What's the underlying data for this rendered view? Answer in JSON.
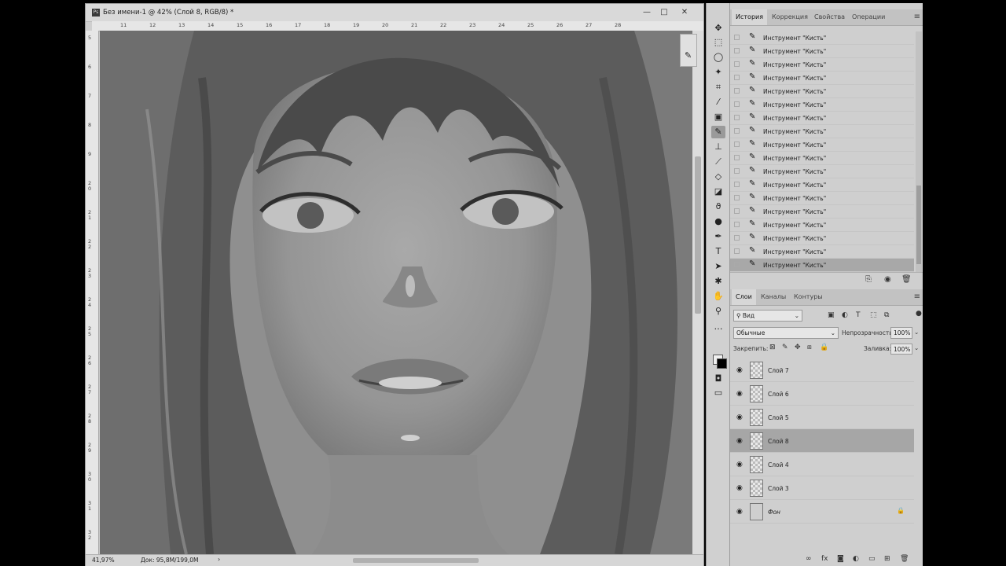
{
  "document": {
    "title": "Без имени-1 @ 42% (Слой 8, RGB/8) *",
    "app_icon": "Ps",
    "window_buttons": [
      "—",
      "□",
      "✕"
    ],
    "ruler_top": [
      "11",
      "12",
      "13",
      "14",
      "15",
      "16",
      "17",
      "18",
      "19",
      "20",
      "21",
      "22",
      "23",
      "24",
      "25",
      "26",
      "27",
      "28"
    ],
    "ruler_left": [
      "5",
      "6",
      "7",
      "8",
      "9",
      "2 0",
      "2 1",
      "2 2",
      "2 3",
      "2 4",
      "2 5",
      "2 6",
      "2 7",
      "2 8",
      "2 9",
      "3 0",
      "3 1",
      "3 2"
    ],
    "zoom": "41,97%",
    "doc_size": "Док: 95,8M/199,0M",
    "status_arrow": "›"
  },
  "tools": [
    {
      "icon": "move-icon",
      "glyph": "✥"
    },
    {
      "icon": "marquee-icon",
      "glyph": "⬚"
    },
    {
      "icon": "lasso-icon",
      "glyph": "◯"
    },
    {
      "icon": "magic-wand-icon",
      "glyph": "✦"
    },
    {
      "icon": "crop-icon",
      "glyph": "⌗"
    },
    {
      "icon": "eyedropper-icon",
      "glyph": "⁄"
    },
    {
      "icon": "frame-icon",
      "glyph": "▣"
    },
    {
      "icon": "brush-icon",
      "glyph": "✎",
      "active": true
    },
    {
      "icon": "stamp-icon",
      "glyph": "⊥"
    },
    {
      "icon": "history-brush-icon",
      "glyph": "⟋"
    },
    {
      "icon": "eraser-icon",
      "glyph": "◇"
    },
    {
      "icon": "bucket-icon",
      "glyph": "◪"
    },
    {
      "icon": "blur-icon",
      "glyph": "ϑ"
    },
    {
      "icon": "dodge-icon",
      "glyph": "●"
    },
    {
      "icon": "pen-icon",
      "glyph": "✒"
    },
    {
      "icon": "type-icon",
      "glyph": "T"
    },
    {
      "icon": "path-select-icon",
      "glyph": "➤"
    },
    {
      "icon": "shape-icon",
      "glyph": "✱"
    },
    {
      "icon": "hand-icon",
      "glyph": "✋"
    },
    {
      "icon": "zoom-icon",
      "glyph": "⚲"
    },
    {
      "icon": "more-icon",
      "glyph": "…"
    }
  ],
  "history": {
    "tabs": [
      "История",
      "Коррекция",
      "Свойства",
      "Операции"
    ],
    "items": [
      "Инструмент \"Кисть\"",
      "Инструмент \"Кисть\"",
      "Инструмент \"Кисть\"",
      "Инструмент \"Кисть\"",
      "Инструмент \"Кисть\"",
      "Инструмент \"Кисть\"",
      "Инструмент \"Кисть\"",
      "Инструмент \"Кисть\"",
      "Инструмент \"Кисть\"",
      "Инструмент \"Кисть\"",
      "Инструмент \"Кисть\"",
      "Инструмент \"Кисть\"",
      "Инструмент \"Кисть\"",
      "Инструмент \"Кисть\"",
      "Инструмент \"Кисть\"",
      "Инструмент \"Кисть\"",
      "Инструмент \"Кисть\"",
      "Инструмент \"Кисть\""
    ],
    "selected_index": 17
  },
  "layers": {
    "tabs": [
      "Слои",
      "Каналы",
      "Контуры"
    ],
    "filter_label": "Вид",
    "blend_mode": "Обычные",
    "opacity_label": "Непрозрачность:",
    "opacity_value": "100%",
    "lock_label": "Закрепить:",
    "fill_label": "Заливка:",
    "fill_value": "100%",
    "items": [
      {
        "name": "Слой 7"
      },
      {
        "name": "Слой 6"
      },
      {
        "name": "Слой 5"
      },
      {
        "name": "Слой 8",
        "selected": true
      },
      {
        "name": "Слой 4"
      },
      {
        "name": "Слой 3"
      },
      {
        "name": "Фон",
        "background": true
      }
    ],
    "footer_icons": [
      "link-icon",
      "fx-icon",
      "mask-icon",
      "adjustment-icon",
      "group-icon",
      "new-layer-icon",
      "trash-icon"
    ],
    "footer_glyphs": [
      "∞",
      "fx",
      "◙",
      "◐",
      "▭",
      "⊞",
      "🗑"
    ]
  },
  "colors": {
    "panel_bg": "#cfcfcf",
    "selected_row": "#a8a8a8"
  }
}
